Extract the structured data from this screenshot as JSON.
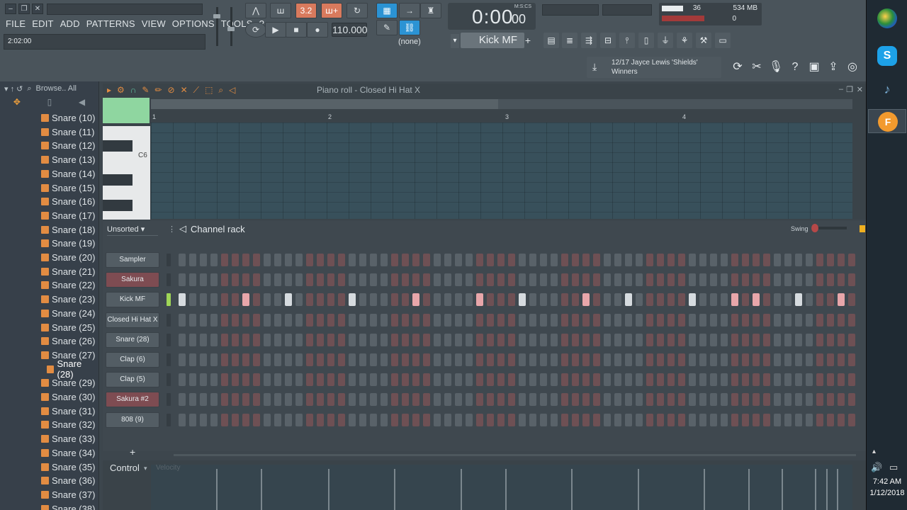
{
  "menu": [
    "FILE",
    "EDIT",
    "ADD",
    "PATTERNS",
    "VIEW",
    "OPTIONS",
    "TOOLS",
    "?"
  ],
  "hint": "2:02:00",
  "tempo": "110.000",
  "time": {
    "main": "0:00",
    "sub": "00",
    "unit": "M:S:CS"
  },
  "pattern_selector": "(none)",
  "selected_channel": "Kick MF",
  "meters": {
    "cpu": "36",
    "ram": "534 MB",
    "polyphony": "0"
  },
  "news": {
    "line1": "12/17  Jayce Lewis 'Shields'",
    "line2": "Winners"
  },
  "browser": {
    "header": "Browse.. All",
    "items": [
      "Snare (10)",
      "Snare (11)",
      "Snare (12)",
      "Snare (13)",
      "Snare (14)",
      "Snare (15)",
      "Snare (16)",
      "Snare (17)",
      "Snare (18)",
      "Snare (19)",
      "Snare (20)",
      "Snare (21)",
      "Snare (22)",
      "Snare (23)",
      "Snare (24)",
      "Snare (25)",
      "Snare (26)",
      "Snare (27)",
      "Snare (28)",
      "Snare (29)",
      "Snare (30)",
      "Snare (31)",
      "Snare (32)",
      "Snare (33)",
      "Snare (34)",
      "Snare (35)",
      "Snare (36)",
      "Snare (37)",
      "Snare (38)"
    ],
    "selected": "Snare (28)"
  },
  "piano_roll": {
    "title": "Piano roll - Closed Hi Hat X",
    "bars": [
      "1",
      "2",
      "3",
      "4"
    ],
    "key_label": "C6"
  },
  "channel_rack": {
    "title": "Channel rack",
    "filter": "Unsorted",
    "swing_label": "Swing",
    "add_button": "+",
    "channels": [
      {
        "name": "Sampler",
        "style": "normal",
        "selected": false,
        "on_steps": []
      },
      {
        "name": "Sakura",
        "style": "red",
        "selected": false,
        "on_steps": []
      },
      {
        "name": "Kick MF",
        "style": "normal",
        "selected": true,
        "on_steps": [
          0,
          6,
          10,
          16,
          22,
          28,
          32,
          38,
          42,
          48,
          52,
          54,
          58,
          62,
          64,
          68,
          71,
          72
        ]
      },
      {
        "name": "Closed Hi Hat X",
        "style": "normal",
        "selected": false,
        "on_steps": []
      },
      {
        "name": "Snare (28)",
        "style": "normal",
        "selected": false,
        "on_steps": []
      },
      {
        "name": "Clap (6)",
        "style": "normal",
        "selected": false,
        "on_steps": []
      },
      {
        "name": "Clap (5)",
        "style": "normal",
        "selected": false,
        "on_steps": []
      },
      {
        "name": "Sakura #2",
        "style": "red",
        "selected": false,
        "on_steps": []
      },
      {
        "name": "808 (9)",
        "style": "normal",
        "selected": false,
        "on_steps": []
      }
    ]
  },
  "event_editor": {
    "label": "Control",
    "sublabel": "Velocity"
  },
  "taskbar": {
    "time": "7:42 AM",
    "date": "1/12/2018"
  },
  "colors": {
    "accent_orange": "#d97a5d",
    "accent_blue": "#2b93d4",
    "led_green": "#9fd657"
  }
}
